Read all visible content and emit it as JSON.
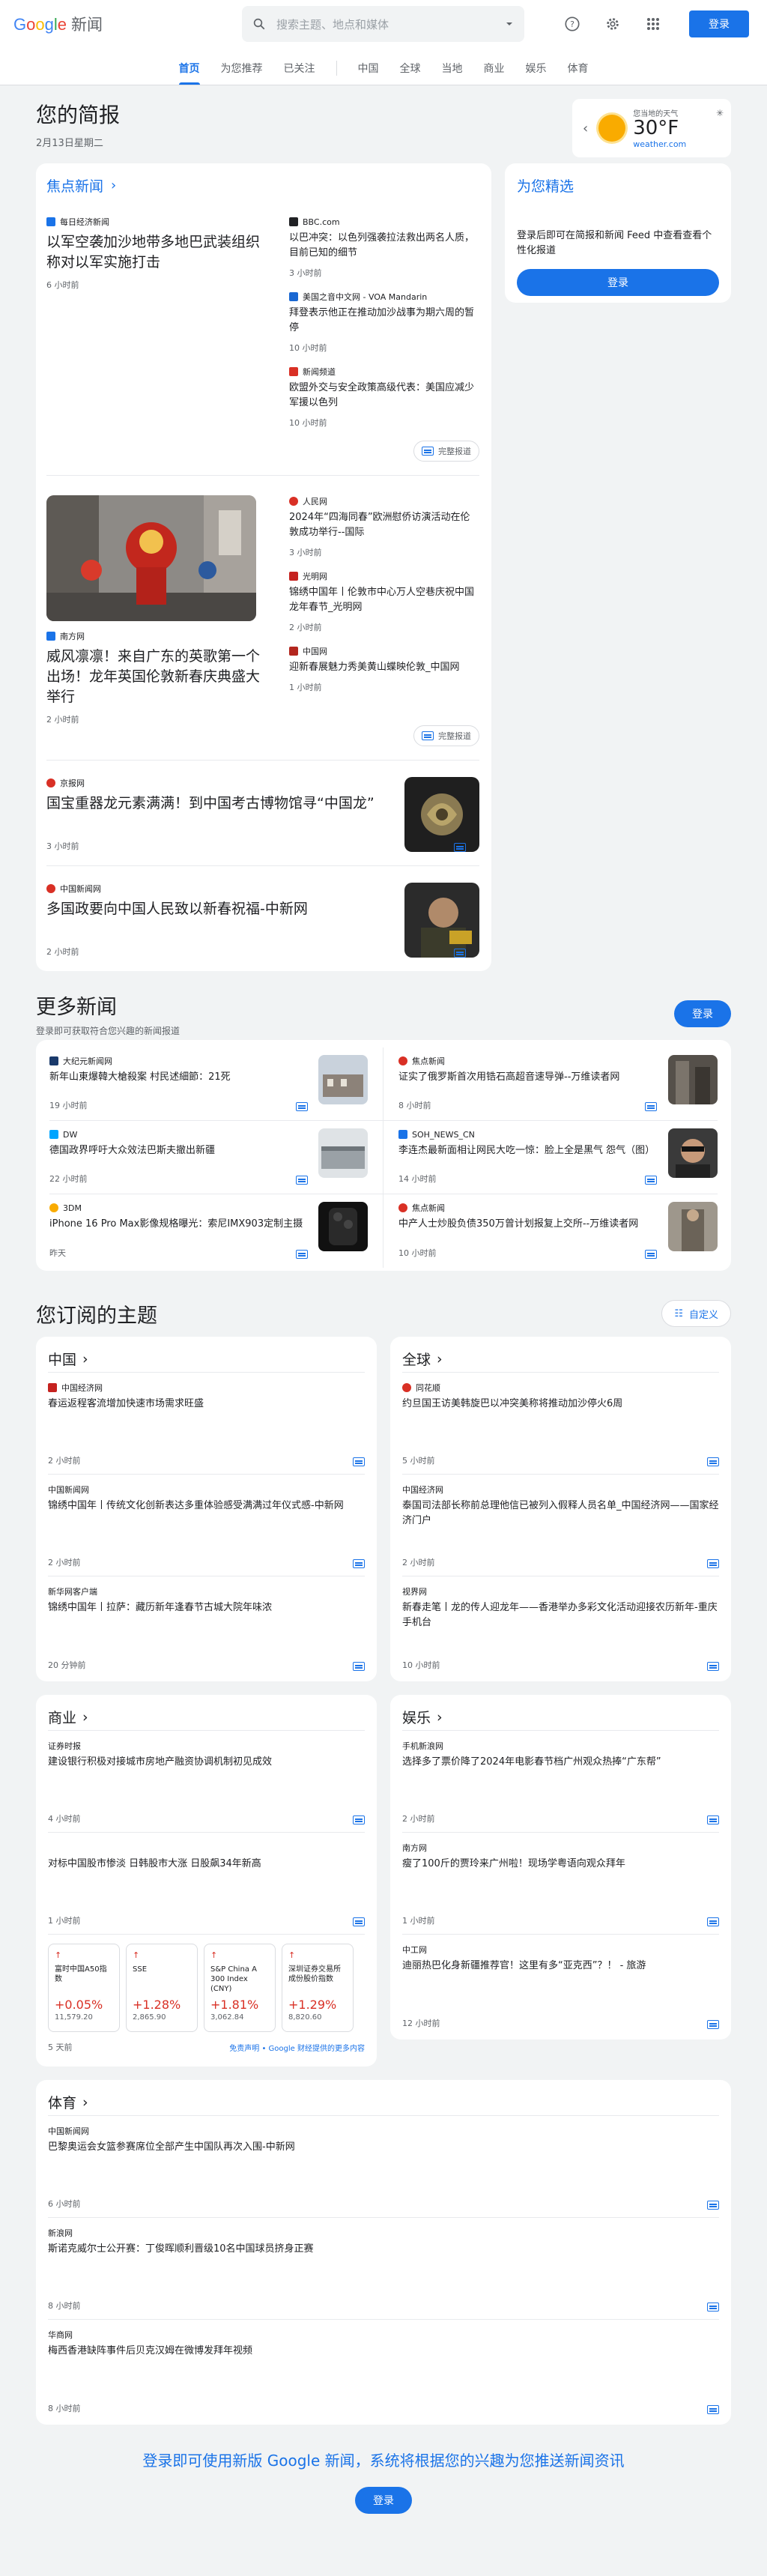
{
  "app": {
    "logo": "Google",
    "name": "新闻",
    "signin": "登录"
  },
  "search": {
    "placeholder": "搜索主题、地点和媒体"
  },
  "tabs": [
    "首页",
    "为您推荐",
    "已关注",
    "中国",
    "全球",
    "当地",
    "商业",
    "娱乐",
    "体育"
  ],
  "briefing": {
    "title": "您的简报",
    "date": "2月13日星期二"
  },
  "weather": {
    "label": "您当地的天气",
    "temp": "30°F",
    "source": "weather.com"
  },
  "top": {
    "title": "焦点新闻",
    "cluster1": {
      "main": {
        "pub": "每日经济新闻",
        "title": "以军空袭加沙地带多地巴武装组织称对以军实施打击",
        "time": "6 小时前"
      },
      "side": [
        {
          "pub": "BBC.com",
          "title": "以巴冲突：以色列强袭拉法救出两名人质，目前已知的细节",
          "time": "3 小时前"
        },
        {
          "pub": "美国之音中文网 - VOA Mandarin",
          "title": "拜登表示他正在推动加沙战事为期六周的暂停",
          "time": "10 小时前"
        },
        {
          "pub": "新闻频道",
          "title": "欧盟外交与安全政策高级代表：美国应减少军援以色列",
          "time": "10 小时前"
        }
      ],
      "coverage": "完整报道"
    },
    "cluster2": {
      "main": {
        "pub": "南方网",
        "title": "威风凛凛！来自广东的英歌第一个出场！龙年英国伦敦新春庆典盛大举行",
        "time": "2 小时前"
      },
      "side": [
        {
          "pub": "人民网",
          "title": "2024年“四海同春”欧洲慰侨访演活动在伦敦成功举行--国际",
          "time": "3 小时前"
        },
        {
          "pub": "光明网",
          "title": "锦绣中国年丨伦敦市中心万人空巷庆祝中国龙年春节_光明网",
          "time": "2 小时前"
        },
        {
          "pub": "中国网",
          "title": "迎新春展魅力秀美黄山蝶映伦敦_中国网",
          "time": "1 小时前"
        }
      ],
      "coverage": "完整报道"
    },
    "single1": {
      "pub": "京报网",
      "title": "国宝重器龙元素满满！到中国考古博物馆寻“中国龙”",
      "time": "3 小时前"
    },
    "single2": {
      "pub": "中国新闻网",
      "title": "多国政要向中国人民致以新春祝福-中新网",
      "time": "2 小时前"
    }
  },
  "picks": {
    "title": "为您精选",
    "text": "登录后即可在简报和新闻 Feed 中查看查看个性化报道",
    "button": "登录"
  },
  "more": {
    "title": "更多新闻",
    "subtitle": "登录即可获取符合您兴趣的新闻报道",
    "button": "登录",
    "items": [
      {
        "pub": "大纪元新闻网",
        "title": "新年山東爆韓大槍殺案 村民述細節：21死",
        "time": "19 小时前"
      },
      {
        "pub": "焦点新闻",
        "title": "证实了俄罗斯首次用锆石高超音速导弹--万维读者网",
        "time": "8 小时前"
      },
      {
        "pub": "DW",
        "title": "德国政界呼吁大众效法巴斯夫撤出新疆",
        "time": "22 小时前"
      },
      {
        "pub": "SOH_NEWS_CN",
        "title": "李连杰最新面相让网民大吃一惊：脸上全是黑气 怨气（图）",
        "time": "14 小时前"
      },
      {
        "pub": "3DM",
        "title": "iPhone 16 Pro Max影像规格曝光：索尼IMX903定制主摄",
        "time": "昨天"
      },
      {
        "pub": "焦点新闻",
        "title": "中产人士炒股负债350万曾计划报复上交所--万维读者网",
        "time": "10 小时前"
      }
    ]
  },
  "topics": {
    "title": "您订阅的主题",
    "customize": "自定义",
    "china": {
      "name": "中国",
      "items": [
        {
          "pub": "中国经济网",
          "title": "春运返程客流增加快速市场需求旺盛",
          "time": "2 小时前"
        },
        {
          "pub": "中国新闻网",
          "title": "锦绣中国年丨传统文化创新表达多重体验感受满满过年仪式感-中新网",
          "time": "2 小时前"
        },
        {
          "pub": "新华网客户端",
          "title": "锦绣中国年丨拉萨：藏历新年逢春节古城大院年味浓",
          "time": "20 分钟前"
        }
      ]
    },
    "world": {
      "name": "全球",
      "items": [
        {
          "pub": "同花顺",
          "title": "约旦国王访美韩旋巴以冲突美称将推动加沙停火6周",
          "time": "5 小时前"
        },
        {
          "pub": "中国经济网",
          "title": "泰国司法部长称前总理他信已被列入假释人员名单_中国经济网——国家经济门户",
          "time": "2 小时前"
        },
        {
          "pub": "视界网",
          "title": "新春走笔丨龙的传人迎龙年——香港举办多彩文化活动迎接农历新年-重庆手机台",
          "time": "10 小时前"
        }
      ]
    },
    "business": {
      "name": "商业",
      "items": [
        {
          "pub": "证券时报",
          "title": "建设银行积极对接城市房地产融资协调机制初见成效",
          "time": "4 小时前"
        },
        {
          "pub": "",
          "title": "对标中国股市惨淡 日韩股市大涨 日股飙34年新高",
          "time": "1 小时前"
        }
      ],
      "stocks": [
        {
          "name": "富时中国A50指数",
          "pct": "+0.05%",
          "value": "11,579.20"
        },
        {
          "name": "SSE",
          "pct": "+1.28%",
          "value": "2,865.90"
        },
        {
          "name": "S&P China A 300 Index (CNY)",
          "pct": "+1.81%",
          "value": "3,062.84"
        },
        {
          "name": "深圳证券交易所成份股价指数",
          "pct": "+1.29%",
          "value": "8,820.60"
        }
      ],
      "stocks_time": "5 天前",
      "disclaimer": "免责声明 • Google 财经提供的更多内容"
    },
    "entertainment": {
      "name": "娱乐",
      "items": [
        {
          "pub": "手机新浪网",
          "title": "选择多了票价降了2024年电影春节档广州观众热捧“广东帮”",
          "time": "2 小时前"
        },
        {
          "pub": "南方网",
          "title": "瘦了100斤的贾玲来广州啦！现场学粤语向观众拜年",
          "time": "1 小时前"
        },
        {
          "pub": "中工网",
          "title": "迪丽热巴化身新疆推荐官！这里有多“亚克西”？！ - 旅游",
          "time": "12 小时前"
        }
      ]
    },
    "sports": {
      "name": "体育",
      "items": [
        {
          "pub": "中国新闻网",
          "title": "巴黎奥运会女篮参赛席位全部产生中国队再次入围-中新网",
          "time": "6 小时前"
        },
        {
          "pub": "新浪网",
          "title": "斯诺克威尔士公开赛：丁俊晖顺利晋级10名中国球员挤身正赛",
          "time": "8 小时前"
        },
        {
          "pub": "华商网",
          "title": "梅西香港缺阵事件后贝克汉姆在微博发拜年视频",
          "time": "8 小时前"
        }
      ]
    }
  },
  "cta": {
    "text": "登录即可使用新版 Google 新闻，系统将根据您的兴趣为您推送新闻资讯",
    "button": "登录"
  }
}
